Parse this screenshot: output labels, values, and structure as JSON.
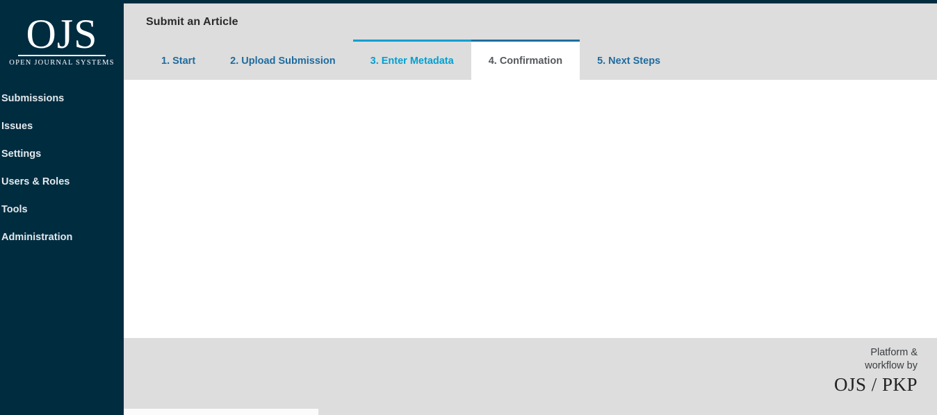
{
  "window": {
    "accent_dark": "#002c40",
    "accent_blue": "#1f6b9e",
    "accent_bright_blue": "#00a0d2",
    "header_bg": "#dddddd",
    "content_bg": "#ffffff"
  },
  "sidebar": {
    "logo": {
      "mark": "OJS",
      "subtitle": "OPEN JOURNAL SYSTEMS"
    },
    "items": [
      {
        "label": "Submissions",
        "name": "sidebar-item-submissions"
      },
      {
        "label": "Issues",
        "name": "sidebar-item-issues"
      },
      {
        "label": "Settings",
        "name": "sidebar-item-settings"
      },
      {
        "label": "Users & Roles",
        "name": "sidebar-item-users-roles"
      },
      {
        "label": "Tools",
        "name": "sidebar-item-tools"
      },
      {
        "label": "Administration",
        "name": "sidebar-item-administration"
      }
    ]
  },
  "header": {
    "title": "Submit an Article"
  },
  "tabs": {
    "items": [
      {
        "label": "1. Start",
        "state": "default"
      },
      {
        "label": "2. Upload Submission",
        "state": "default"
      },
      {
        "label": "3. Enter Metadata",
        "state": "hover"
      },
      {
        "label": "4. Confirmation",
        "state": "active"
      },
      {
        "label": "5. Next Steps",
        "state": "default"
      }
    ],
    "active_index": 3
  },
  "main": {
    "body_text": ""
  },
  "footer": {
    "line1": "Platform &",
    "line2": "workflow by",
    "logo": "OJS / PKP"
  },
  "scrollbar": {
    "orientation": "horizontal",
    "thumb_position": "left"
  }
}
